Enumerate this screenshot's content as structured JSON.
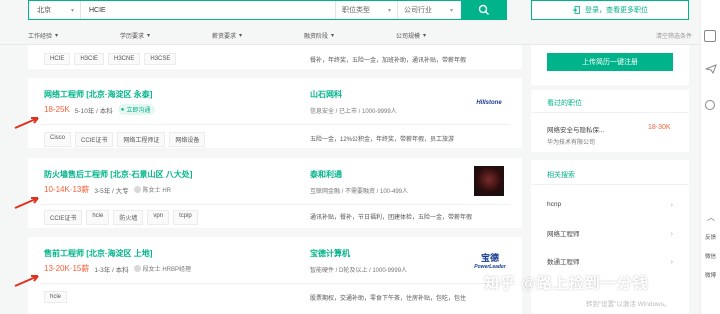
{
  "search": {
    "city": "北京",
    "query": "HCIE",
    "position_type": "职位类型",
    "company_industry": "公司行业"
  },
  "login_label": "登录，查看更多职位",
  "filters": [
    "工作经验",
    "学历要求",
    "薪资要求",
    "融资阶段",
    "公司规模"
  ],
  "clear_filters": "清空筛选条件",
  "top_card": {
    "tags": [
      "HCIE",
      "H3CIE",
      "H3CNE",
      "H3CSE"
    ],
    "welfare": "餐补，年终奖，五险一金，加班补助，通讯补贴，带薪年假"
  },
  "jobs": [
    {
      "title": "网络工程师  [北京·海淀区 永泰]",
      "salary": "18-25K",
      "meta": "5-10年 / 本科",
      "badge": "立即沟通",
      "company": "山石网科",
      "company_meta": "信息安全  /  已上市  /  1000-9999人",
      "logo_text": "Hillstone",
      "tags": [
        "Cisco",
        "CCIE证书",
        "网络工程师证",
        "网络设备"
      ],
      "welfare": "五险一金，12%公积金，年终奖，带薪年假，员工旅游"
    },
    {
      "title": "防火墙售后工程师  [北京·石景山区 八大处]",
      "salary": "10-14K·13薪",
      "meta": "3-5年 / 大专",
      "hr": "陈女士  HR",
      "company": "泰和利通",
      "company_meta": "互联网金融  /  不需要融资  /  100-499人",
      "tags": [
        "CCIE证书",
        "hcie",
        "防火墙",
        "vpn",
        "tcpip"
      ],
      "welfare": "通讯补贴，餐补，节日福利，团建体检，五险一金，带薪年假"
    },
    {
      "title": "售前工程师  [北京·海淀区 上地]",
      "salary": "13-20K·15薪",
      "meta": "1-3年 / 本科",
      "hr": "段女士  HRBP经理",
      "company": "宝德计算机",
      "company_meta": "智能硬件  /  D轮及以上  /  1000-9999人",
      "logo_text": "PowerLeader",
      "tags": [
        "hcie"
      ],
      "welfare": "股票期权，交通补助，零食下午茶，住房补贴，包吃，包住"
    }
  ],
  "sidebar": {
    "upload_button": "上传简历一键注册",
    "viewed_title": "看过的职位",
    "viewed_job": "网络安全与隐私保...",
    "viewed_salary": "18-30K",
    "viewed_company": "华为技术有限公司",
    "related_title": "相关搜索",
    "related": [
      "hcnp",
      "网络工程师",
      "数通工程师"
    ]
  },
  "rightbar": [
    "反馈",
    "微信",
    "微博"
  ],
  "watermark": "知乎 @路上捡到一分钱",
  "windows_hint": "转到“设置”以激活 Windows。"
}
